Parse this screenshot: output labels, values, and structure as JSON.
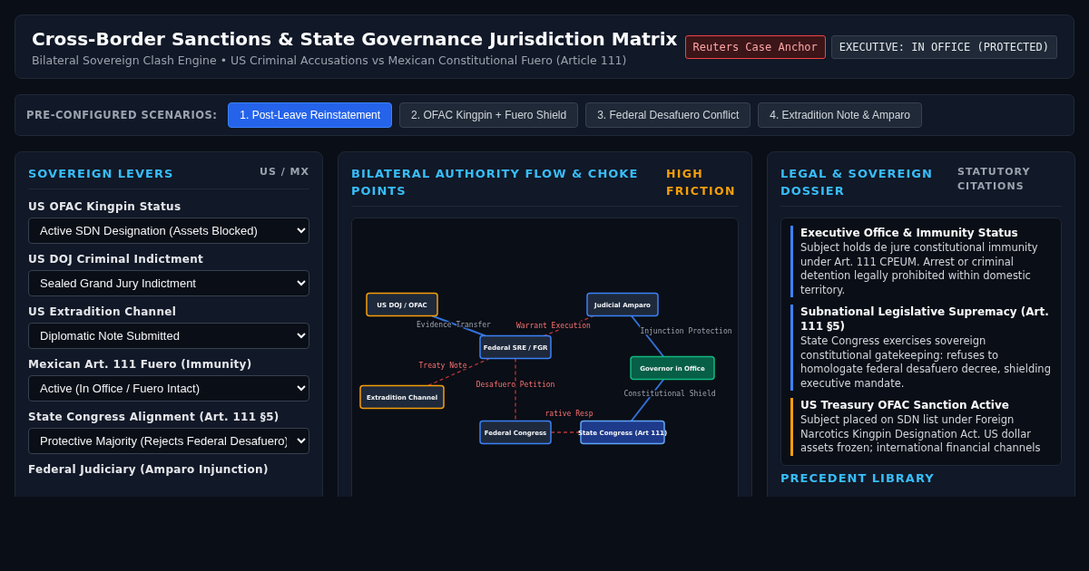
{
  "header": {
    "title": "Cross-Border Sanctions & State Governance Jurisdiction Matrix",
    "subtitle": "Bilateral Sovereign Clash Engine • US Criminal Accusations vs Mexican Constitutional Fuero (Article 111)",
    "badges": [
      {
        "label": "Reuters Case Anchor",
        "kind": "alert"
      },
      {
        "label": "EXECUTIVE: IN OFFICE (PROTECTED)",
        "kind": "status"
      }
    ]
  },
  "scenarios": {
    "label": "PRE-CONFIGURED SCENARIOS:",
    "items": [
      {
        "label": "1. Post-Leave Reinstatement",
        "selected": true
      },
      {
        "label": "2. OFAC Kingpin + Fuero Shield",
        "selected": false
      },
      {
        "label": "3. Federal Desafuero Conflict",
        "selected": false
      },
      {
        "label": "4. Extradition Note & Amparo",
        "selected": false
      }
    ]
  },
  "levers": {
    "title": "SOVEREIGN LEVERS",
    "tag": "US / MX",
    "fields": [
      {
        "label": "US OFAC Kingpin Status",
        "value": "Active SDN Designation (Assets Blocked)"
      },
      {
        "label": "US DOJ Criminal Indictment",
        "value": "Sealed Grand Jury Indictment"
      },
      {
        "label": "US Extradition Channel",
        "value": "Diplomatic Note Submitted"
      },
      {
        "label": "Mexican Art. 111 Fuero (Immunity)",
        "value": "Active (In Office / Fuero Intact)"
      },
      {
        "label": "State Congress Alignment (Art. 111 §5)",
        "value": "Protective Majority (Rejects Federal Desafuero)"
      },
      {
        "label": "Federal Judiciary (Amparo Injunction)"
      }
    ]
  },
  "flow": {
    "title": "BILATERAL AUTHORITY FLOW & CHOKE POINTS",
    "tag": "HIGH FRICTION",
    "nodes": [
      {
        "label": "US DOJ / OFAC",
        "kind": "us"
      },
      {
        "label": "Judicial Amparo",
        "kind": "mx"
      },
      {
        "label": "Federal SRE / FGR",
        "kind": "mx"
      },
      {
        "label": "Governor in Office",
        "kind": "governor"
      },
      {
        "label": "Extradition Channel",
        "kind": "us"
      },
      {
        "label": "Federal Congress",
        "kind": "mx"
      },
      {
        "label": "State Congress (Art 111)",
        "kind": "state"
      }
    ],
    "edges": [
      {
        "label": "Evidence Transfer",
        "kind": "support"
      },
      {
        "label": "Warrant Execution",
        "kind": "conflict"
      },
      {
        "label": "Injunction Protection",
        "kind": "support"
      },
      {
        "label": "Treaty Note",
        "kind": "conflict"
      },
      {
        "label": "Desafuero Petition",
        "kind": "conflict"
      },
      {
        "label": "Constitutional Shield",
        "kind": "support"
      },
      {
        "label": "rative Resp",
        "kind": "conflict"
      }
    ]
  },
  "dossier": {
    "title": "LEGAL & SOVEREIGN DOSSIER",
    "tag": "STATUTORY CITATIONS",
    "entries": [
      {
        "title": "Executive Office & Immunity Status",
        "text": "Subject holds de jure constitutional immunity under Art. 111 CPEUM. Arrest or criminal detention legally prohibited within domestic territory.",
        "color": "#3b82f6"
      },
      {
        "title": "Subnational Legislative Supremacy (Art. 111 §5)",
        "text": "State Congress exercises sovereign constitutional gatekeeping: refuses to homologate federal desafuero decree, shielding executive mandate.",
        "color": "#3b82f6"
      },
      {
        "title": "US Treasury OFAC Sanction Active",
        "text": "Subject placed on SDN list under Foreign Narcotics Kingpin Designation Act. US dollar assets frozen; international financial channels",
        "color": "#f59e0b"
      }
    ],
    "next_section": "PRECEDENT LIBRARY"
  }
}
